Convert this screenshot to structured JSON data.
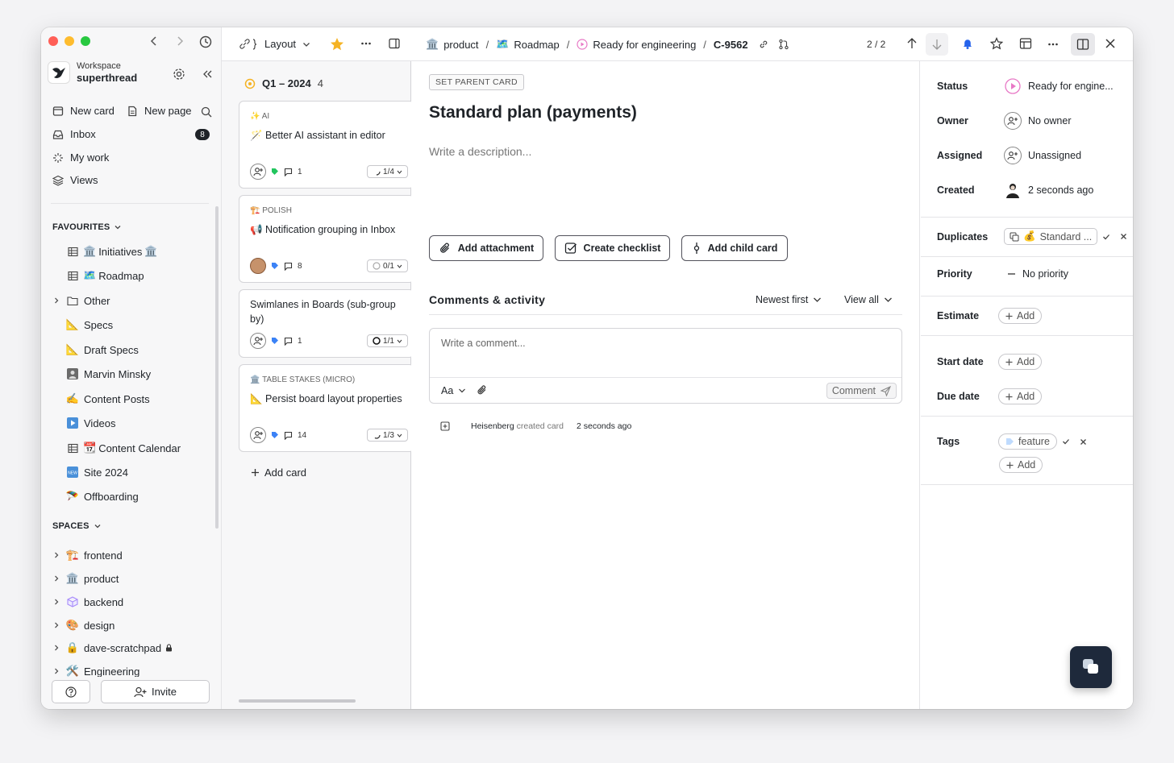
{
  "sidebar": {
    "workspace_label": "Workspace",
    "workspace_name": "superthread",
    "new_card": "New card",
    "new_page": "New page",
    "inbox": "Inbox",
    "inbox_count": "8",
    "my_work": "My work",
    "views": "Views",
    "favourites_heading": "FAVOURITES",
    "favourites": [
      {
        "label": "Initiatives",
        "suffix": "🏛️"
      },
      {
        "label": "Roadmap"
      },
      {
        "label": "Other"
      },
      {
        "label": "Specs"
      },
      {
        "label": "Draft Specs"
      },
      {
        "label": "Marvin Minsky"
      },
      {
        "label": "Content Posts"
      },
      {
        "label": "Videos"
      },
      {
        "label": "Content Calendar"
      },
      {
        "label": "Site 2024"
      },
      {
        "label": "Offboarding"
      }
    ],
    "spaces_heading": "SPACES",
    "spaces": [
      {
        "label": "frontend"
      },
      {
        "label": "product"
      },
      {
        "label": "backend"
      },
      {
        "label": "design"
      },
      {
        "label": "dave-scratchpad"
      },
      {
        "label": "Engineering"
      }
    ],
    "invite": "Invite"
  },
  "board": {
    "layout_label": "Layout",
    "column_title": "Q1 – 2024",
    "column_count": "4",
    "cards": [
      {
        "tag": "AI",
        "title": "Better AI assistant in editor",
        "comments": "1",
        "progress": "1/4"
      },
      {
        "tag": "POLISH",
        "title": "Notification grouping in Inbox",
        "comments": "8",
        "progress": "0/1"
      },
      {
        "tag": "",
        "title": "Swimlanes in Boards (sub-group by)",
        "comments": "1",
        "progress": "1/1"
      },
      {
        "tag": "TABLE STAKES (MICRO)",
        "title": "Persist board layout properties",
        "comments": "14",
        "progress": "1/3"
      }
    ],
    "add_card": "Add card"
  },
  "detail": {
    "breadcrumb": {
      "space": "product",
      "board": "Roadmap",
      "status": "Ready for engineering",
      "card_id": "C-9562"
    },
    "pager": "2 / 2",
    "set_parent": "SET PARENT CARD",
    "title": "Standard plan (payments)",
    "description_placeholder": "Write a description...",
    "add_attachment": "Add attachment",
    "create_checklist": "Create checklist",
    "add_child_card": "Add child card",
    "comments_heading": "Comments & activity",
    "sort": "Newest first",
    "filter": "View all",
    "comment_placeholder": "Write a comment...",
    "text_format": "Aa",
    "comment_button": "Comment",
    "activity": {
      "user": "Heisenberg",
      "action": "created card",
      "time": "2 seconds ago"
    }
  },
  "properties": {
    "status_label": "Status",
    "status_value": "Ready for engine...",
    "owner_label": "Owner",
    "owner_value": "No owner",
    "assigned_label": "Assigned",
    "assigned_value": "Unassigned",
    "created_label": "Created",
    "created_value": "2 seconds ago",
    "duplicates_label": "Duplicates",
    "duplicates_value": "Standard ...",
    "priority_label": "Priority",
    "priority_value": "No priority",
    "estimate_label": "Estimate",
    "start_label": "Start date",
    "due_label": "Due date",
    "tags_label": "Tags",
    "tag_value": "feature",
    "add": "Add"
  },
  "colors": {
    "accent": "#1e293b",
    "status_pink": "#e879c6",
    "tag_blue": "#3b82f6",
    "star": "#f5b324",
    "bell": "#2563eb"
  }
}
